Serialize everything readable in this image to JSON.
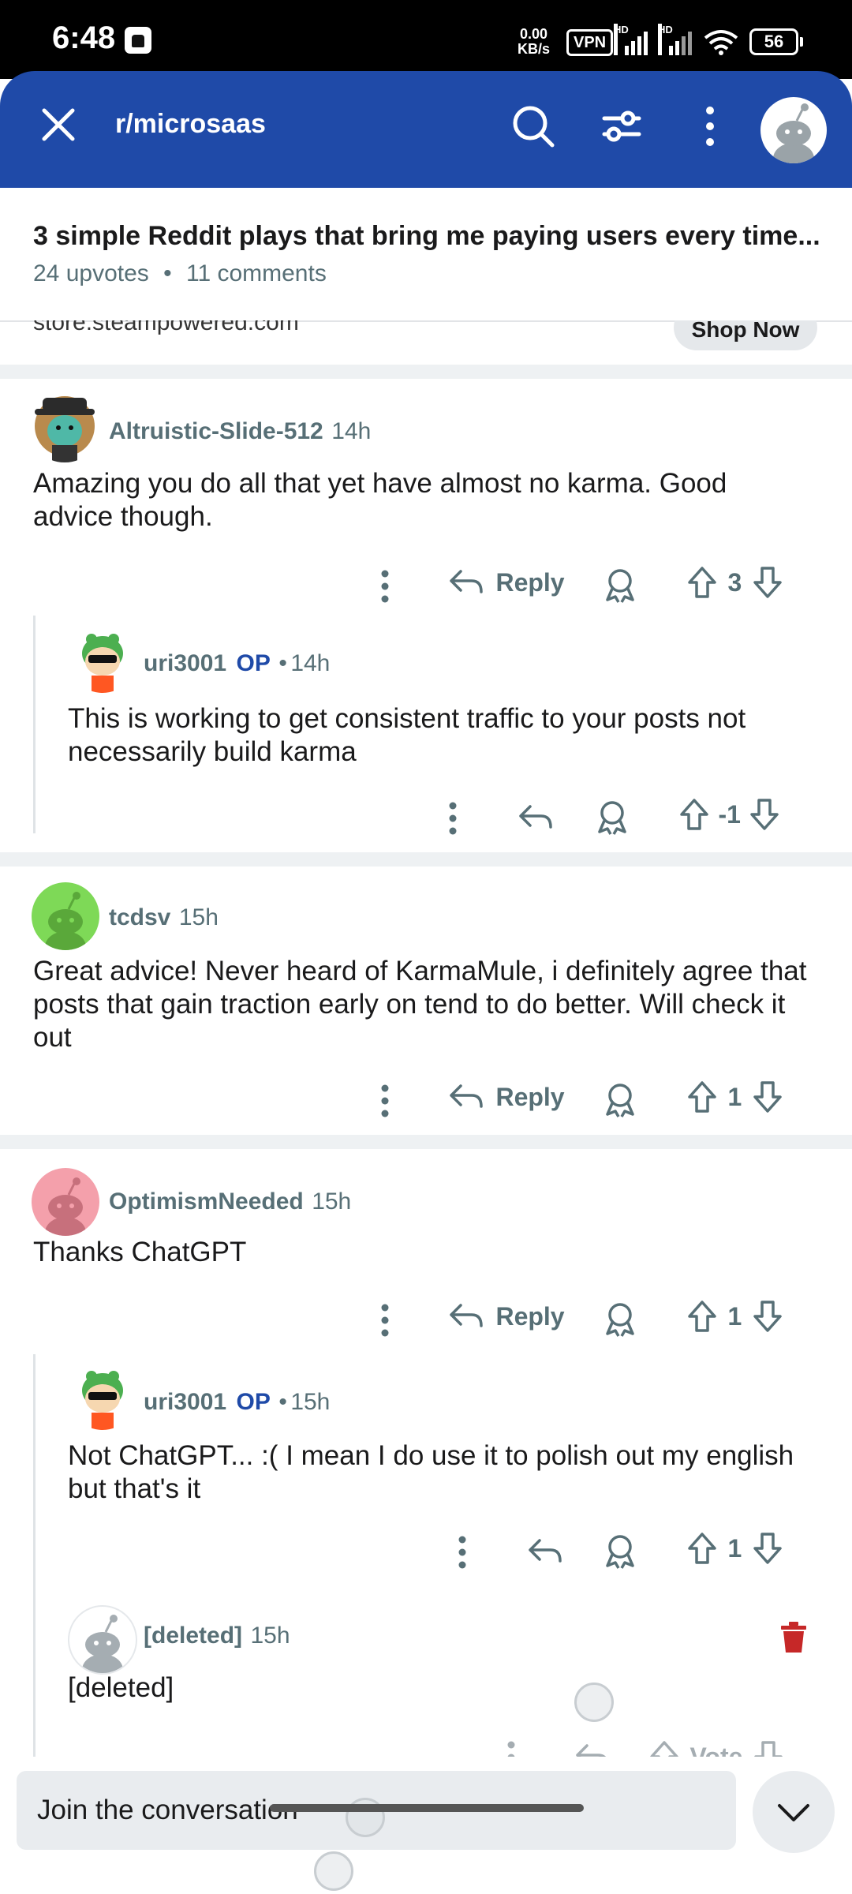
{
  "status_bar": {
    "time": "6:48",
    "net_speed_value": "0.00",
    "net_speed_unit": "KB/s",
    "vpn": "VPN",
    "sim1_label": "HD",
    "sim2_label": "HD",
    "battery": "56"
  },
  "header": {
    "subreddit": "r/microsaas"
  },
  "post": {
    "title": "3 simple Reddit plays that bring me paying users every time...",
    "upvotes": "24 upvotes",
    "separator": "•",
    "comments": "11 comments"
  },
  "ad": {
    "domain": "store.steampowered.com",
    "cta": "Shop Now"
  },
  "comments": [
    {
      "username": "Altruistic-Slide-512",
      "time": "14h",
      "body": "Amazing you do all that yet have almost no karma. Good advice though.",
      "reply_label": "Reply",
      "votes": "3"
    },
    {
      "username": "uri3001",
      "op_tag": "OP",
      "dot": "•",
      "time": "14h",
      "body": "This is working to get consistent traffic to your posts not necessarily build karma",
      "votes": "-1"
    },
    {
      "username": "tcdsv",
      "time": "15h",
      "body": "Great advice! Never heard of KarmaMule, i definitely agree that posts that gain traction early on tend to do better. Will check it out",
      "reply_label": "Reply",
      "votes": "1"
    },
    {
      "username": "OptimismNeeded",
      "time": "15h",
      "body": "Thanks ChatGPT",
      "reply_label": "Reply",
      "votes": "1"
    },
    {
      "username": "uri3001",
      "op_tag": "OP",
      "dot": "•",
      "time": "15h",
      "body": "Not ChatGPT... :( I mean I do use it to polish out my english but that's it",
      "votes": "1"
    },
    {
      "username": "[deleted]",
      "time": "15h",
      "body": "[deleted]",
      "vote_label": "Vote"
    }
  ],
  "composer": {
    "placeholder": "Join the conversation"
  },
  "colors": {
    "header_blue": "#1f4aa8",
    "op_blue": "#1f4aa8",
    "delete_red": "#c62828",
    "meta_gray": "#576f76"
  },
  "icons": [
    "close-icon",
    "search-icon",
    "filter-icon",
    "more-vertical-icon",
    "reply-icon",
    "award-icon",
    "upvote-icon",
    "downvote-icon",
    "trash-icon",
    "chevron-down-icon"
  ]
}
